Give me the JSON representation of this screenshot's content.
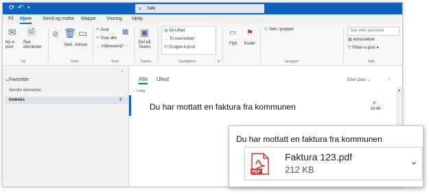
{
  "titlebar": {
    "search_label": "Søk",
    "accent": "#0f62be"
  },
  "menu": {
    "items": [
      "Fil",
      "Hjem",
      "Send og motta",
      "Mappe",
      "Visning",
      "Hjelp"
    ],
    "active": "Hjem"
  },
  "ribbon": {
    "new_email": "Ny e-post",
    "new_items": "Nye elementer",
    "delete": "Slett",
    "archive": "Arkiver",
    "reply": "Svar",
    "reply_all": "Svar alle",
    "forward": "Videresend",
    "share_teams": "Del på Teams",
    "quick_1": "00-Utfart",
    "quick_2": "Til overordnet",
    "quick_3": "Gruppe-e-post",
    "move": "Flytt",
    "tags": "Koder",
    "search_groups": "Søk i grupper",
    "search_people": "Søk etter personer",
    "address_book": "Adressebok",
    "filter_email": "Filtrer e-post",
    "groups": {
      "new": "Ny",
      "delete": "Slett",
      "respond": "Svar",
      "teams": "Teams",
      "quick_steps": "Hurtigtrinn",
      "groups": "Grupper",
      "find": "Søk"
    }
  },
  "sidebar": {
    "favorites": "Favoritter",
    "folders": [
      {
        "label": "Sendte elementer",
        "count": ""
      },
      {
        "label": "Innboks",
        "count": "3"
      }
    ]
  },
  "mail": {
    "tab_all": "Alle",
    "tab_unread": "Ulest",
    "sort_label": "Etter Dato",
    "today_label": "I dag",
    "message": {
      "subject": "Du har mottatt en faktura fra kommunen",
      "time": "10:00"
    }
  },
  "callout": {
    "title": "Du har mottatt en faktura fra kommunen",
    "attachment": {
      "name": "Faktura 123.pdf",
      "size": "212 KB",
      "icon": "pdf-icon",
      "icon_color": "#d9342b"
    }
  }
}
